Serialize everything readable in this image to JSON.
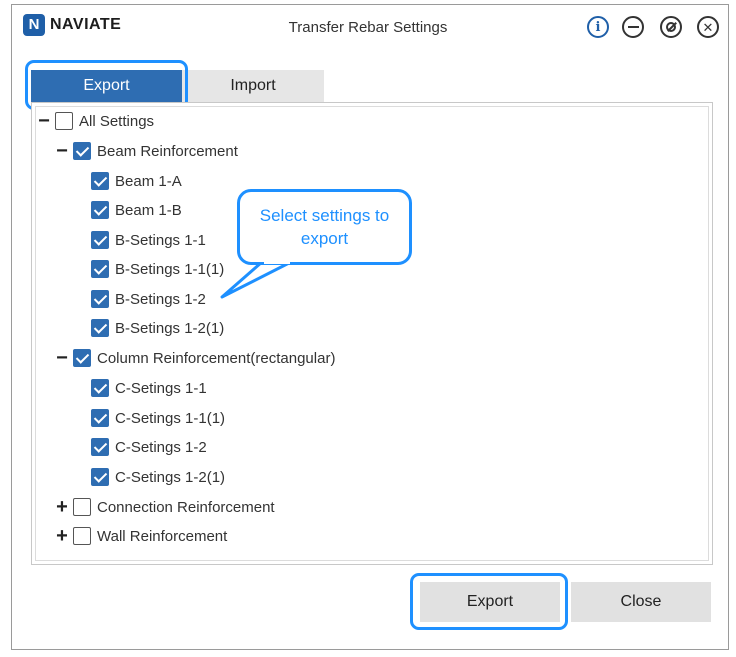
{
  "app": {
    "logo_mark": "N",
    "logo_text": "NAVIATE",
    "title": "Transfer Rebar Settings"
  },
  "window_controls": {
    "info_glyph": "i",
    "close_glyph": "✕"
  },
  "tabs": [
    {
      "label": "Export",
      "active": true
    },
    {
      "label": "Import",
      "active": false
    }
  ],
  "tree": {
    "root": {
      "label": "All Settings",
      "checked": false,
      "expanded": true
    },
    "groups": [
      {
        "label": "Beam Reinforcement",
        "checked": true,
        "expanded": true,
        "items": [
          {
            "label": "Beam 1-A",
            "checked": true
          },
          {
            "label": "Beam 1-B",
            "checked": true
          },
          {
            "label": "B-Setings 1-1",
            "checked": true
          },
          {
            "label": "B-Setings 1-1(1)",
            "checked": true
          },
          {
            "label": "B-Setings 1-2",
            "checked": true
          },
          {
            "label": "B-Setings 1-2(1)",
            "checked": true
          }
        ]
      },
      {
        "label": "Column Reinforcement(rectangular)",
        "checked": true,
        "expanded": true,
        "items": [
          {
            "label": "C-Setings 1-1",
            "checked": true
          },
          {
            "label": "C-Setings 1-1(1)",
            "checked": true
          },
          {
            "label": "C-Setings 1-2",
            "checked": true
          },
          {
            "label": "C-Setings 1-2(1)",
            "checked": true
          }
        ]
      },
      {
        "label": "Connection Reinforcement",
        "checked": false,
        "expanded": false,
        "items": []
      },
      {
        "label": "Wall Reinforcement",
        "checked": false,
        "expanded": false,
        "items": []
      }
    ],
    "expanded_glyph": "−",
    "collapsed_glyph": "+"
  },
  "callout": {
    "text": "Select settings to export"
  },
  "buttons": {
    "export": "Export",
    "close": "Close"
  },
  "colors": {
    "accent": "#2e6db2",
    "highlight": "#1e90ff"
  }
}
